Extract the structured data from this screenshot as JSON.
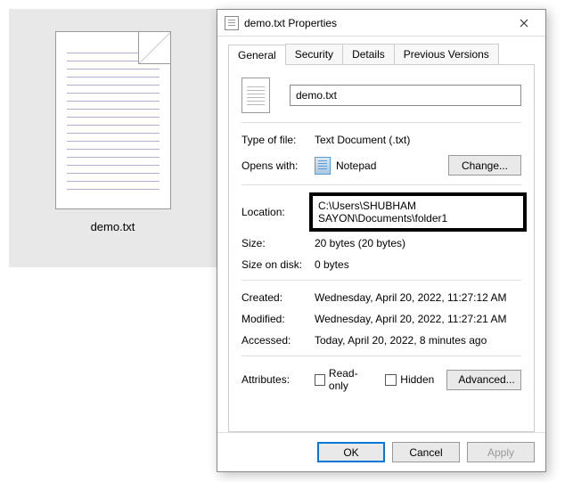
{
  "desktop": {
    "file_label": "demo.txt"
  },
  "dialog": {
    "title": "demo.txt Properties",
    "tabs": [
      "General",
      "Security",
      "Details",
      "Previous Versions"
    ],
    "filename": "demo.txt",
    "labels": {
      "type_of_file": "Type of file:",
      "opens_with": "Opens with:",
      "location": "Location:",
      "size": "Size:",
      "size_on_disk": "Size on disk:",
      "created": "Created:",
      "modified": "Modified:",
      "accessed": "Accessed:",
      "attributes": "Attributes:"
    },
    "values": {
      "type_of_file": "Text Document (.txt)",
      "opens_with": "Notepad",
      "location": "C:\\Users\\SHUBHAM SAYON\\Documents\\folder1",
      "size": "20 bytes (20 bytes)",
      "size_on_disk": "0 bytes",
      "created": "Wednesday, April 20, 2022, 11:27:12 AM",
      "modified": "Wednesday, April 20, 2022, 11:27:21 AM",
      "accessed": "Today, April 20, 2022, 8 minutes ago"
    },
    "buttons": {
      "change": "Change...",
      "advanced": "Advanced...",
      "ok": "OK",
      "cancel": "Cancel",
      "apply": "Apply"
    },
    "checkboxes": {
      "readonly": "Read-only",
      "hidden": "Hidden"
    }
  }
}
